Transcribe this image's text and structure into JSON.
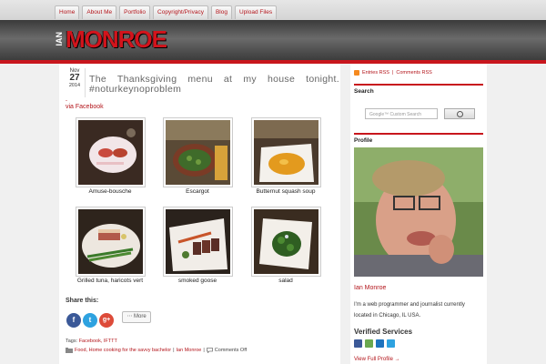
{
  "nav": [
    "Home",
    "About Me",
    "Portfolio",
    "Copyright/Privacy",
    "Blog",
    "Upload Files"
  ],
  "logo": {
    "small": "IAN",
    "big": "MONROE"
  },
  "post": {
    "date": {
      "month": "Nov",
      "day": "27",
      "year": "2014"
    },
    "title": "The Thanksgiving menu at my house tonight. #noturkeynoproblem",
    "via_dot": "-",
    "via": "via Facebook",
    "photos": [
      {
        "caption": "Amuse-bousche",
        "icon": "amuse-bouche-photo"
      },
      {
        "caption": "Escargot",
        "icon": "escargot-photo"
      },
      {
        "caption": "Butternut squash soup",
        "icon": "soup-photo"
      },
      {
        "caption": "Grilled tuna, haricots vert",
        "icon": "tuna-photo"
      },
      {
        "caption": "smoked goose",
        "icon": "goose-photo"
      },
      {
        "caption": "salad",
        "icon": "salad-photo"
      }
    ],
    "share_label": "Share this:",
    "social": [
      {
        "letter": "f",
        "color": "#3b5998",
        "icon": "facebook-icon"
      },
      {
        "letter": "t",
        "color": "#2ea2e0",
        "icon": "twitter-icon"
      },
      {
        "letter": "g+",
        "color": "#dd4b39",
        "icon": "google-plus-icon"
      }
    ],
    "more_label": "More",
    "tags_label": "Tags:",
    "tags": "Facebook, IFTTT",
    "categories": "Food, Home cooking for the savvy bachelor",
    "author": "Ian Monroe",
    "comments": "Comments Off"
  },
  "sidebar": {
    "rss_entries": "Entries RSS",
    "rss_sep": "|",
    "rss_comments": "Comments RSS",
    "search_heading": "Search",
    "search_placeholder": "Google™ Custom Search",
    "profile_heading": "Profile",
    "name": "Ian Monroe",
    "bio": "I'm a web programmer and journalist currently located in Chicago, IL USA.",
    "verified_heading": "Verified Services",
    "verified_icons": [
      {
        "color": "#3b5998",
        "icon": "facebook-icon"
      },
      {
        "color": "#6aa84f",
        "icon": "verified-service-icon"
      },
      {
        "color": "#1e73be",
        "icon": "linkedin-icon"
      },
      {
        "color": "#2ea2e0",
        "icon": "twitter-icon"
      }
    ],
    "full_profile": "View Full Profile →"
  },
  "colors": {
    "accent": "#c8161d",
    "link": "#b3151b"
  }
}
